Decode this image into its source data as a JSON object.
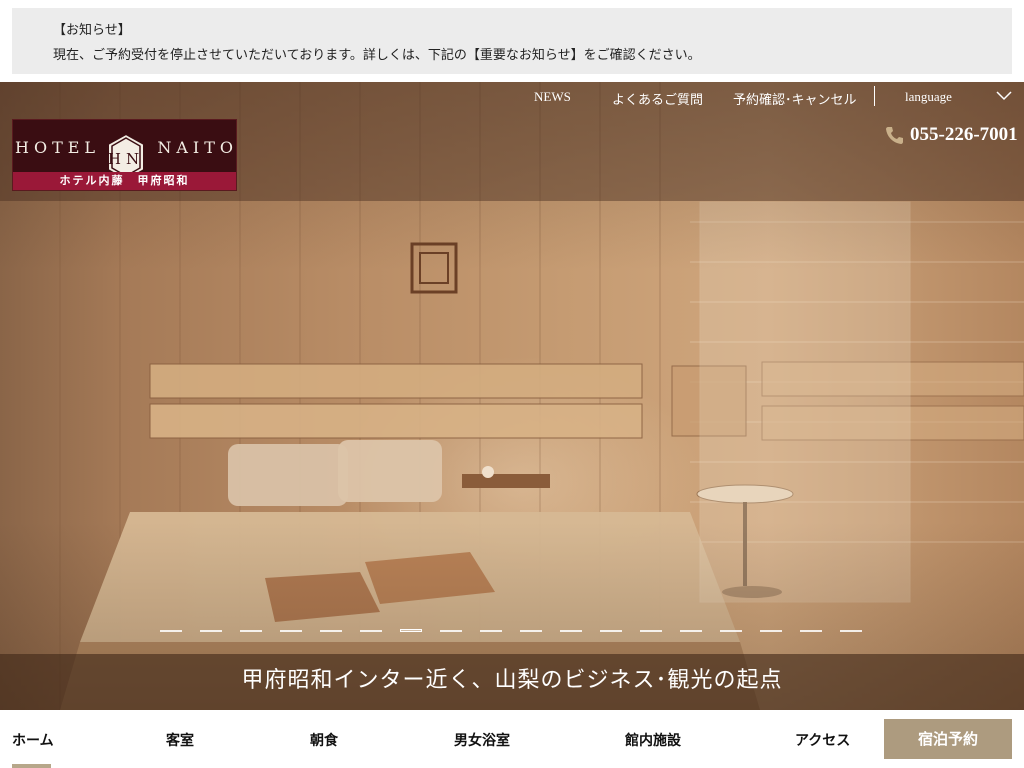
{
  "notice": {
    "title": "【お知らせ】",
    "message": "現在、ご予約受付を停止させていただいております。詳しくは、下記の【重要なお知らせ】をご確認ください。"
  },
  "header": {
    "logo": {
      "brand_left": "HOTEL",
      "emblem_text": "HN",
      "brand_right": "NAITO",
      "subtitle": "ホテル内藤　甲府昭和"
    },
    "top_nav": {
      "news": "NEWS",
      "faq": "よくあるご質問",
      "reservation_confirm": "予約確認･キャンセル",
      "language": "language"
    },
    "phone": "055-226-7001",
    "phone_icon": "phone-icon"
  },
  "hero": {
    "caption": "甲府昭和インター近く、山梨のビジネス･観光の起点",
    "slides_count": 18,
    "active_slide": 7
  },
  "main_nav": {
    "home": "ホーム",
    "rooms": "客室",
    "breakfast": "朝食",
    "bath": "男女浴室",
    "facilities": "館内施設",
    "access": "アクセス",
    "reserve": "宿泊予約"
  },
  "colors": {
    "notice_bg": "#ececec",
    "logo_bg": "#3a0d12",
    "logo_accent": "#9a1838",
    "reserve_button": "#ad9b7f"
  }
}
